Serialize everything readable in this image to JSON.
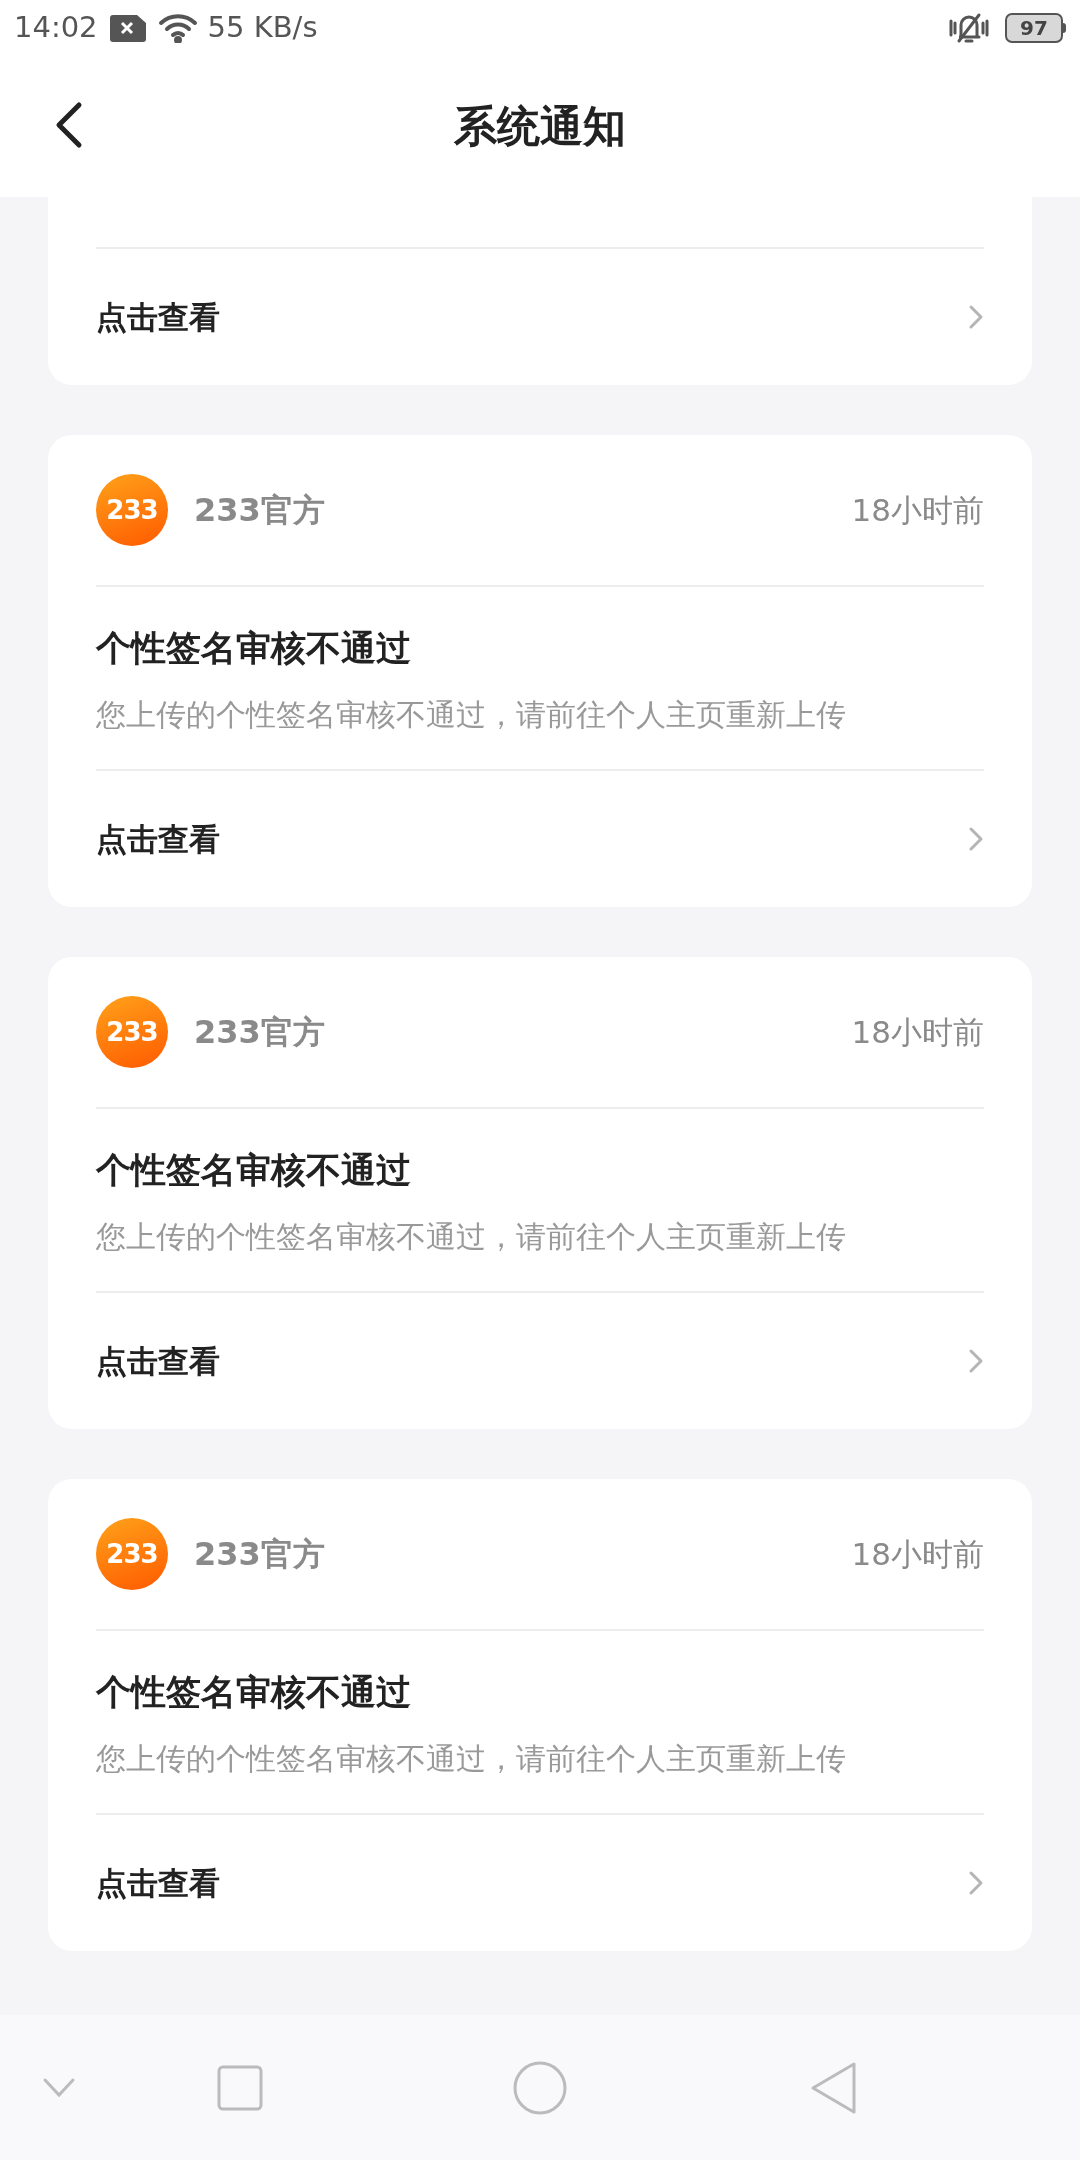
{
  "status_bar": {
    "time": "14:02",
    "net_speed": "55 KB/s",
    "battery": "97"
  },
  "header": {
    "title": "系统通知"
  },
  "notifications": [
    {
      "kind": "partial",
      "link": "点击查看"
    },
    {
      "kind": "full",
      "logo": "233",
      "sender": "233官方",
      "time": "18小时前",
      "title": "个性签名审核不通过",
      "body": "您上传的个性签名审核不通过，请前往个人主页重新上传",
      "link": "点击查看"
    },
    {
      "kind": "full",
      "logo": "233",
      "sender": "233官方",
      "time": "18小时前",
      "title": "个性签名审核不通过",
      "body": "您上传的个性签名审核不通过，请前往个人主页重新上传",
      "link": "点击查看"
    },
    {
      "kind": "full",
      "logo": "233",
      "sender": "233官方",
      "time": "18小时前",
      "title": "个性签名审核不通过",
      "body": "您上传的个性签名审核不通过，请前往个人主页重新上传",
      "link": "点击查看"
    }
  ]
}
